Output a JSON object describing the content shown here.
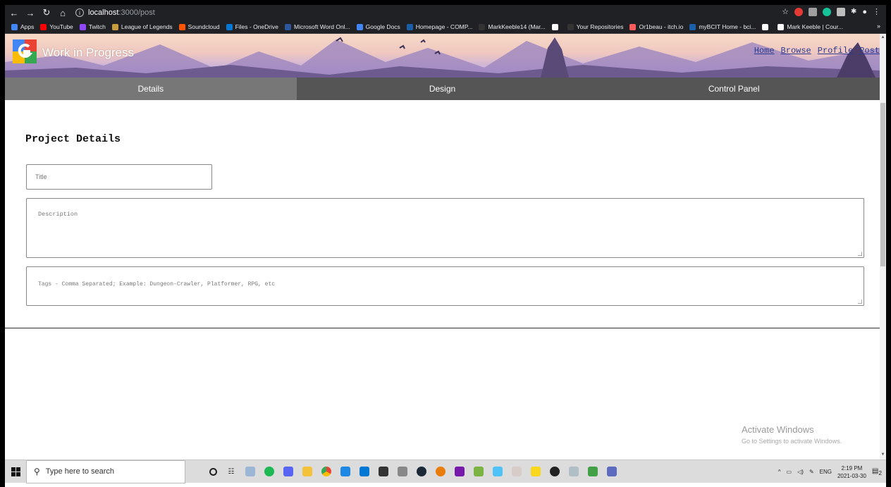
{
  "browser": {
    "url_host": "localhost",
    "url_path": ":3000/post",
    "bookmarks": [
      {
        "label": "Apps",
        "color": "#4285f4"
      },
      {
        "label": "YouTube",
        "color": "#ff0000"
      },
      {
        "label": "Twitch",
        "color": "#9146ff"
      },
      {
        "label": "League of Legends",
        "color": "#c89b3c"
      },
      {
        "label": "Soundcloud",
        "color": "#ff5500"
      },
      {
        "label": "Files - OneDrive",
        "color": "#0078d4"
      },
      {
        "label": "Microsoft Word Onl...",
        "color": "#2b579a"
      },
      {
        "label": "Google Docs",
        "color": "#4285f4"
      },
      {
        "label": "Homepage - COMP...",
        "color": "#1a5fa8"
      },
      {
        "label": "MarkKeeble14 (Mar...",
        "color": "#333333"
      },
      {
        "label": "",
        "color": "#ffffff"
      },
      {
        "label": "Your Repositories",
        "color": "#333333"
      },
      {
        "label": "Or1beau - itch.io",
        "color": "#fa5c5c"
      },
      {
        "label": "myBCIT Home - bci...",
        "color": "#1a5fa8"
      },
      {
        "label": "",
        "color": "#ffffff"
      },
      {
        "label": "Mark Keeble | Cour...",
        "color": "#ffffff"
      }
    ],
    "bookmarks_more": "»"
  },
  "site": {
    "title": "Work in Progress",
    "nav": [
      "Home",
      "Browse",
      "Profile",
      "Post"
    ]
  },
  "tabs": [
    {
      "label": "Details",
      "active": true
    },
    {
      "label": "Design",
      "active": false
    },
    {
      "label": "Control Panel",
      "active": false
    }
  ],
  "form": {
    "heading": "Project Details",
    "title_placeholder": "Title",
    "description_placeholder": "Description",
    "tags_placeholder": "Tags - Comma Separated; Example: Dungeon-Crawler, Platformer, RPG, etc"
  },
  "watermark": {
    "line1": "Activate Windows",
    "line2": "Go to Settings to activate Windows."
  },
  "taskbar": {
    "search_placeholder": "Type here to search",
    "language": "ENG",
    "time": "2:19 PM",
    "date": "2021-03-30",
    "notifications": "2"
  }
}
